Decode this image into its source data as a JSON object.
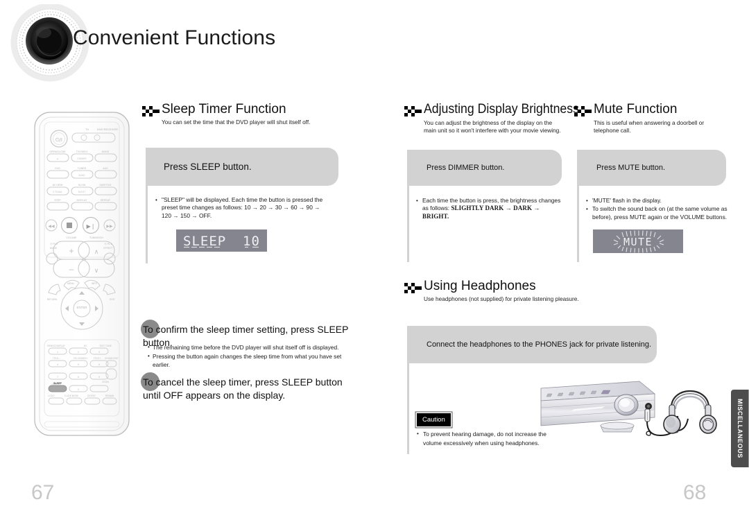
{
  "header": {
    "title": "Convenient Functions",
    "logo_icon": "speaker-woofer-icon"
  },
  "page_numbers": {
    "left": "67",
    "right": "68"
  },
  "side_tab": {
    "label": "MISCELLANEOUS"
  },
  "sections": {
    "sleep": {
      "title": "Sleep Timer Function",
      "subtitle": "You can set the time that the DVD player will shut itself off.",
      "banner": "Press SLEEP button.",
      "bullets": [
        "\"SLEEP\" will be displayed. Each time the button is pressed the preset time changes as follows: 10 → 20 → 30 → 60 → 90 → 120 → 150 → OFF."
      ],
      "display": "SLEEP   10",
      "statement_1": "To confirm the sleep timer setting, press SLEEP button.",
      "statement_1_bullets": [
        "The remaining time before the DVD player will shut itself off is displayed.",
        "Pressing the button again changes the sleep time from what you have set earlier."
      ],
      "statement_2": "To cancel the sleep timer, press SLEEP button until OFF appears on the display."
    },
    "dimmer": {
      "title": "Adjusting Display Brightness",
      "subtitle_line1": "You can adjust the brightness of the display on the",
      "subtitle_line2": "main unit so it won't interfere with your movie viewing.",
      "banner": "Press DIMMER button.",
      "bullet_lead": "Each time the button is press, the brightness changes as follows: ",
      "bullet_emphasis": "SLIGHTLY DARK → DARK → BRIGHT."
    },
    "mute": {
      "title": "Mute Function",
      "subtitle_line1": "This is useful when answering a doorbell or",
      "subtitle_line2": "telephone call.",
      "banner": "Press MUTE button.",
      "bullets": [
        "'MUTE' flash in the display.",
        "To switch the sound back on (at the same volume as before), press MUTE again or the VOLUME buttons."
      ],
      "display": "MUTE"
    },
    "headphones": {
      "title": "Using Headphones",
      "subtitle": "Use headphones (not supplied) for private listening pleasure.",
      "banner": "Connect the headphones to the PHONES jack for private listening.",
      "caution_label": "Caution",
      "caution_bullet": "To prevent hearing damage, do not increase the volume excessively when using headphones."
    }
  },
  "remote": {
    "name": "remote-control-illustration",
    "power_label": "⏻/I",
    "mode_labels": [
      "TV",
      "DVD RECEIVER"
    ],
    "row1": [
      "OPEN/CLOSE",
      "TV/VIDEO",
      "MODE"
    ],
    "row1_sub": [
      "▲",
      "DIMMER",
      ""
    ],
    "row2": [
      "DVD",
      "TUNER",
      "AUX"
    ],
    "row2_sub": [
      "",
      "BAND",
      ""
    ],
    "row3": [
      "AV VIEW",
      "SLOW",
      "SUBTITLE"
    ],
    "row3_sub": [
      "V-TONAL",
      "MO/ST",
      ""
    ],
    "row4": [
      "STEP",
      "DISPLAY",
      "REPEAT"
    ],
    "transport": [
      "⏮",
      "■",
      "▶❙❙",
      "⏭"
    ],
    "knob_labels": [
      "VOLUME",
      "TUNING/CH"
    ],
    "left_side": [
      "Ⓓ PL Ⅱ",
      "MODE"
    ],
    "right_side": [
      "Ⓓ PL Ⅱ",
      "EFFECT"
    ],
    "dpad_labels": [
      "MENU",
      "INFO",
      "RETURN",
      "EXIT",
      "ENTER"
    ],
    "keypad_top": [
      "REMOCON/PLAY",
      "DV",
      "TEST TONE"
    ],
    "keypad": [
      "1",
      "2",
      "3",
      "4",
      "5",
      "6",
      "7",
      "8",
      "9",
      "0"
    ],
    "keypad_labels": [
      "TITLE–",
      "P/D SEARCH",
      "TITLE+",
      "SOUND EDIT",
      "CANCEL",
      "ZOOM",
      "LOGO",
      "S.LIDE MODE",
      "DIGEST",
      "REMAIN"
    ],
    "highlight_button": "SLEEP"
  }
}
